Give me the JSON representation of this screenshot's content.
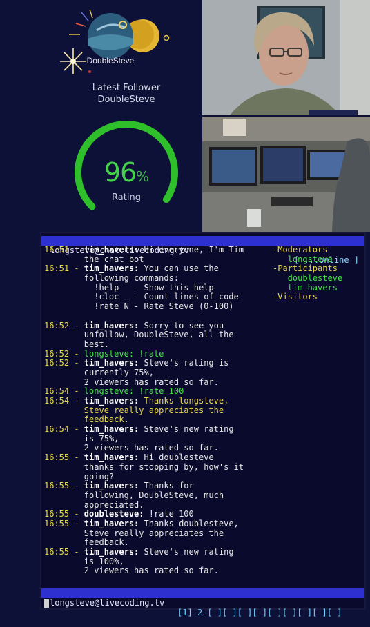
{
  "overlay": {
    "follower_title": "Latest Follower",
    "follower_name": "DoubleSteve",
    "rating_number": "96",
    "rating_percent": "%",
    "rating_label": "Rating",
    "rating_fraction": 0.96,
    "gauge_color": "#2fbf2a"
  },
  "terminal": {
    "top_host": "longsteve@chat.livecoding.tv",
    "top_status": "[ ...online ]",
    "bottom_host": "longsteve@livecoding.tv",
    "bottom_windows": "[1]-2-[ ][ ][ ][ ][ ][ ][ ][ ][ ]",
    "chat_lines": [
      {
        "ts": "16:51 - ",
        "nick": "tim_havers:",
        "text": " Hi everyone, I'm Tim",
        "style": "white"
      },
      {
        "ts": "",
        "nick": "",
        "text": "        the chat bot",
        "style": "white"
      },
      {
        "ts": "16:51 - ",
        "nick": "tim_havers:",
        "text": " You can use the",
        "style": "white"
      },
      {
        "ts": "",
        "nick": "",
        "text": "        following commands:",
        "style": "white"
      },
      {
        "ts": "",
        "nick": "",
        "text": "          !help   - Show this help",
        "style": "white"
      },
      {
        "ts": "",
        "nick": "",
        "text": "          !cloc   - Count lines of code",
        "style": "white"
      },
      {
        "ts": "",
        "nick": "",
        "text": "          !rate N - Rate Steve (0-100)",
        "style": "white"
      },
      {
        "ts": "",
        "nick": "",
        "text": "",
        "style": "white"
      },
      {
        "ts": "16:52 - ",
        "nick": "tim_havers:",
        "text": " Sorry to see you",
        "style": "white"
      },
      {
        "ts": "",
        "nick": "",
        "text": "        unfollow, DoubleSteve, all the",
        "style": "white"
      },
      {
        "ts": "",
        "nick": "",
        "text": "        best.",
        "style": "white"
      },
      {
        "ts": "16:52 - ",
        "nick": "longsteve:",
        "text": " !rate",
        "style": "green"
      },
      {
        "ts": "16:52 - ",
        "nick": "tim_havers:",
        "text": " Steve's rating is",
        "style": "white"
      },
      {
        "ts": "",
        "nick": "",
        "text": "        currently 75%,",
        "style": "white"
      },
      {
        "ts": "",
        "nick": "",
        "text": "        2 viewers has rated so far.",
        "style": "white"
      },
      {
        "ts": "16:54 - ",
        "nick": "longsteve:",
        "text": " !rate 100",
        "style": "green"
      },
      {
        "ts": "16:54 - ",
        "nick": "tim_havers:",
        "text": " Thanks longsteve,",
        "style": "yellow"
      },
      {
        "ts": "",
        "nick": "",
        "text": "        Steve really appreciates the",
        "style": "yellow"
      },
      {
        "ts": "",
        "nick": "",
        "text": "        feedback.",
        "style": "yellow"
      },
      {
        "ts": "16:54 - ",
        "nick": "tim_havers:",
        "text": " Steve's new rating",
        "style": "white"
      },
      {
        "ts": "",
        "nick": "",
        "text": "        is 75%,",
        "style": "white"
      },
      {
        "ts": "",
        "nick": "",
        "text": "        2 viewers has rated so far.",
        "style": "white"
      },
      {
        "ts": "16:55 - ",
        "nick": "tim_havers:",
        "text": " Hi doublesteve",
        "style": "white"
      },
      {
        "ts": "",
        "nick": "",
        "text": "        thanks for stopping by, how's it",
        "style": "white"
      },
      {
        "ts": "",
        "nick": "",
        "text": "        going?",
        "style": "white"
      },
      {
        "ts": "16:55 - ",
        "nick": "tim_havers:",
        "text": " Thanks for",
        "style": "white"
      },
      {
        "ts": "",
        "nick": "",
        "text": "        following, DoubleSteve, much",
        "style": "white"
      },
      {
        "ts": "",
        "nick": "",
        "text": "        appreciated.",
        "style": "white"
      },
      {
        "ts": "16:55 - ",
        "nick": "doublesteve:",
        "text": " !rate 100",
        "style": "white"
      },
      {
        "ts": "16:55 - ",
        "nick": "tim_havers:",
        "text": " Thanks doublesteve,",
        "style": "white"
      },
      {
        "ts": "",
        "nick": "",
        "text": "        Steve really appreciates the",
        "style": "white"
      },
      {
        "ts": "",
        "nick": "",
        "text": "        feedback.",
        "style": "white"
      },
      {
        "ts": "16:55 - ",
        "nick": "tim_havers:",
        "text": " Steve's new rating",
        "style": "white"
      },
      {
        "ts": "",
        "nick": "",
        "text": "        is 100%,",
        "style": "white"
      },
      {
        "ts": "",
        "nick": "",
        "text": "        2 viewers has rated so far.",
        "style": "white"
      }
    ],
    "userlist": [
      {
        "text": "-Moderators",
        "kind": "head"
      },
      {
        "text": "   longsteve",
        "kind": "user"
      },
      {
        "text": "-Participants",
        "kind": "head"
      },
      {
        "text": "   doublesteve",
        "kind": "user"
      },
      {
        "text": "   tim_havers",
        "kind": "user"
      },
      {
        "text": "-Visitors",
        "kind": "head"
      }
    ]
  }
}
